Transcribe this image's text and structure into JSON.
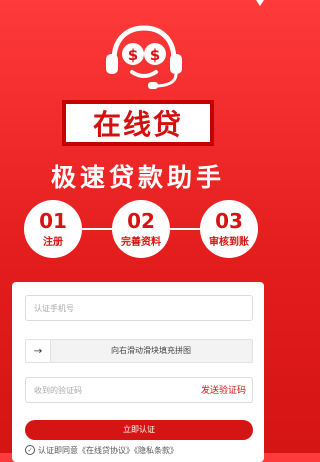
{
  "brand": {
    "name": "在线贷",
    "tagline": "极速贷款助手"
  },
  "steps": [
    {
      "num": "01",
      "label": "注册"
    },
    {
      "num": "02",
      "label": "完善资料"
    },
    {
      "num": "03",
      "label": "审核到账"
    }
  ],
  "form": {
    "phone_placeholder": "认证手机号",
    "slider_arrow": "→",
    "slider_text": "向右滑动滑块填充拼图",
    "code_placeholder": "收到的验证码",
    "send_code_label": "发送验证码",
    "submit_label": "立即认证",
    "agreement": "认证即同意《在线贷协议》《隐私条款》"
  },
  "colors": {
    "primary_red": "#d51414",
    "white": "#ffffff"
  }
}
